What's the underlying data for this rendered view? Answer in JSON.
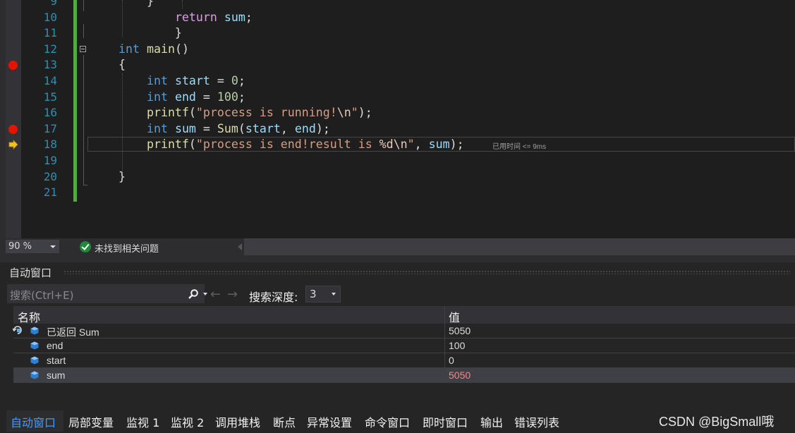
{
  "editor": {
    "lines": [
      {
        "n": "9",
        "tokens": [
          {
            "t": "    }",
            "c": ""
          }
        ]
      },
      {
        "n": "10",
        "tokens": [
          {
            "t": "        ",
            "c": ""
          },
          {
            "t": "return",
            "c": "kw2"
          },
          {
            "t": " ",
            "c": ""
          },
          {
            "t": "sum",
            "c": "var"
          },
          {
            "t": ";",
            "c": ""
          }
        ]
      },
      {
        "n": "11",
        "tokens": [
          {
            "t": "        }",
            "c": ""
          }
        ]
      },
      {
        "n": "12",
        "tokens": [
          {
            "t": "int",
            "c": "kw"
          },
          {
            "t": " ",
            "c": ""
          },
          {
            "t": "main",
            "c": "fn"
          },
          {
            "t": "()",
            "c": ""
          }
        ]
      },
      {
        "n": "13",
        "tokens": [
          {
            "t": "{",
            "c": ""
          }
        ]
      },
      {
        "n": "14",
        "tokens": [
          {
            "t": "    ",
            "c": ""
          },
          {
            "t": "int",
            "c": "kw"
          },
          {
            "t": " ",
            "c": ""
          },
          {
            "t": "start",
            "c": "var"
          },
          {
            "t": " = ",
            "c": ""
          },
          {
            "t": "0",
            "c": "num"
          },
          {
            "t": ";",
            "c": ""
          }
        ]
      },
      {
        "n": "15",
        "tokens": [
          {
            "t": "    ",
            "c": ""
          },
          {
            "t": "int",
            "c": "kw"
          },
          {
            "t": " ",
            "c": ""
          },
          {
            "t": "end",
            "c": "var"
          },
          {
            "t": " = ",
            "c": ""
          },
          {
            "t": "100",
            "c": "num"
          },
          {
            "t": ";",
            "c": ""
          }
        ]
      },
      {
        "n": "16",
        "tokens": [
          {
            "t": "    ",
            "c": ""
          },
          {
            "t": "printf",
            "c": "fn"
          },
          {
            "t": "(",
            "c": ""
          },
          {
            "t": "\"process is running!",
            "c": "str"
          },
          {
            "t": "\\n",
            "c": "esc"
          },
          {
            "t": "\"",
            "c": "str"
          },
          {
            "t": ");",
            "c": ""
          }
        ]
      },
      {
        "n": "17",
        "tokens": [
          {
            "t": "    ",
            "c": ""
          },
          {
            "t": "int",
            "c": "kw"
          },
          {
            "t": " ",
            "c": ""
          },
          {
            "t": "sum",
            "c": "var"
          },
          {
            "t": " = ",
            "c": ""
          },
          {
            "t": "Sum",
            "c": "fn"
          },
          {
            "t": "(",
            "c": ""
          },
          {
            "t": "start",
            "c": "var"
          },
          {
            "t": ", ",
            "c": ""
          },
          {
            "t": "end",
            "c": "var"
          },
          {
            "t": ");",
            "c": ""
          }
        ]
      },
      {
        "n": "18",
        "tokens": [
          {
            "t": "    ",
            "c": ""
          },
          {
            "t": "printf",
            "c": "fn"
          },
          {
            "t": "(",
            "c": ""
          },
          {
            "t": "\"process is end!result is ",
            "c": "str"
          },
          {
            "t": "%d",
            "c": "esc"
          },
          {
            "t": "\\n",
            "c": "esc"
          },
          {
            "t": "\"",
            "c": "str"
          },
          {
            "t": ", ",
            "c": ""
          },
          {
            "t": "sum",
            "c": "var"
          },
          {
            "t": ");",
            "c": ""
          }
        ]
      },
      {
        "n": "19",
        "tokens": []
      },
      {
        "n": "20",
        "tokens": [
          {
            "t": "}",
            "c": ""
          }
        ]
      },
      {
        "n": "21",
        "tokens": []
      }
    ],
    "breakpoint_lines": [
      "13",
      "17"
    ],
    "current_line": "18",
    "elapsed_hint": "已用时间 <= 9ms"
  },
  "statusbar": {
    "zoom": "90 %",
    "issues": "未找到相关问题"
  },
  "autos": {
    "title": "自动窗口",
    "search_placeholder": "搜索(Ctrl+E)",
    "depth_label": "搜索深度:",
    "depth_value": "3",
    "columns": {
      "name": "名称",
      "value": "值"
    },
    "rows": [
      {
        "name": "已返回 Sum",
        "value": "5050",
        "returned": true
      },
      {
        "name": "end",
        "value": "100"
      },
      {
        "name": "start",
        "value": "0"
      },
      {
        "name": "sum",
        "value": "5050",
        "changed": true
      }
    ],
    "selected_row_index": 3
  },
  "tabs": [
    "自动窗口",
    "局部变量",
    "监视 1",
    "监视 2",
    "调用堆栈",
    "断点",
    "异常设置",
    "命令窗口",
    "即时窗口",
    "输出",
    "错误列表"
  ],
  "active_tab": "自动窗口",
  "watermark": "CSDN @BigSmall哦",
  "colors": {
    "keyword": "#569cd6",
    "control_keyword": "#d8a0df",
    "function": "#dcdcaa",
    "variable": "#9cdcfe",
    "string": "#d69d85",
    "number": "#b5cea8",
    "line_number": "#2b91af",
    "breakpoint": "#e51400",
    "changed_value": "#f48787",
    "active_tab": "#3e9cff"
  }
}
